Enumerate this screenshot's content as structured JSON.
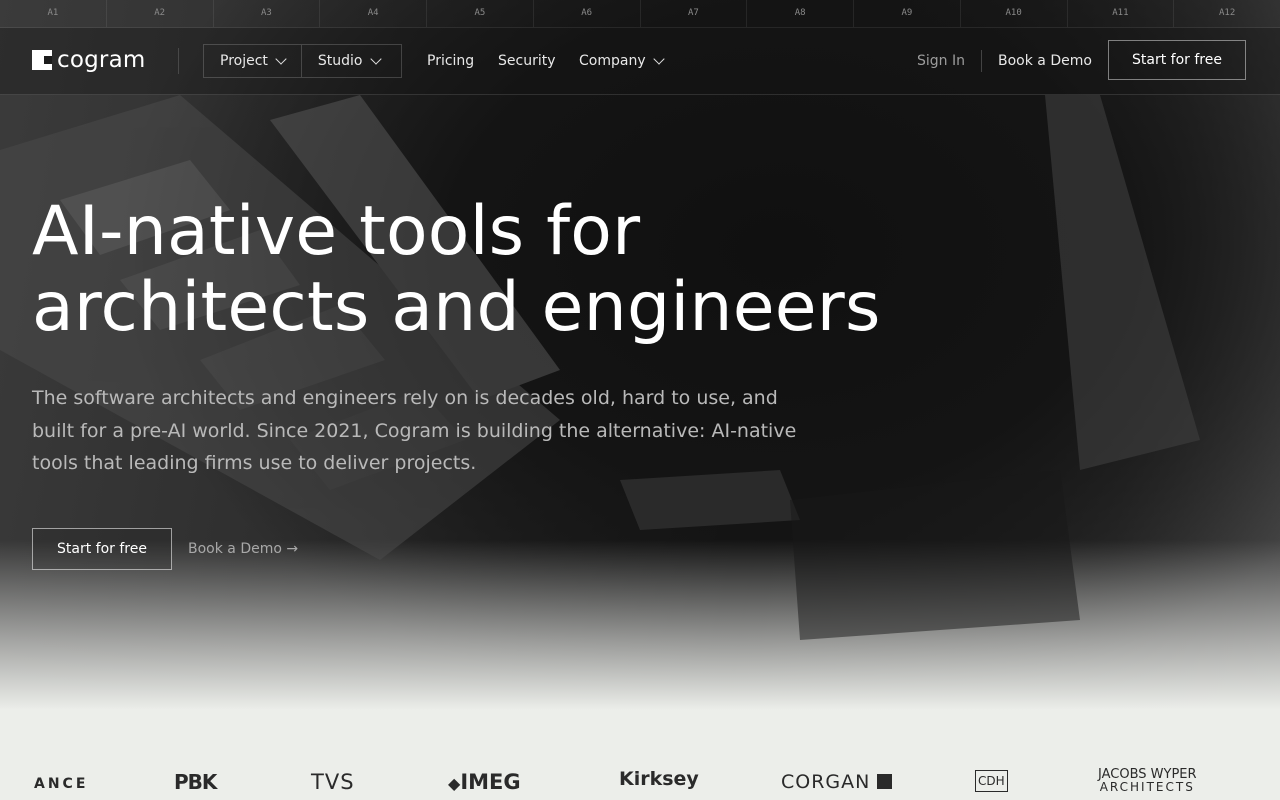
{
  "columns": [
    "A1",
    "A2",
    "A3",
    "A4",
    "A5",
    "A6",
    "A7",
    "A8",
    "A9",
    "A10",
    "A11",
    "A12"
  ],
  "brand": {
    "name": "cogram"
  },
  "nav": {
    "dropdowns": [
      {
        "label": "Project"
      },
      {
        "label": "Studio"
      }
    ],
    "links": [
      "Pricing",
      "Security"
    ],
    "company": "Company",
    "sign_in": "Sign In",
    "book_demo": "Book a Demo",
    "start_free": "Start for free"
  },
  "hero": {
    "headline_line1": "AI-native tools for",
    "headline_line2": "architects and engineers",
    "subcopy": "The software architects and engineers rely on is decades old, hard to use, and built for a pre-AI world. Since 2021, Cogram is building the alternative: AI-native tools that leading firms use to deliver projects.",
    "cta_primary": "Start for free",
    "cta_secondary": "Book a Demo →"
  },
  "clients": [
    "ANCE",
    "PBK",
    "TVS",
    "IMEG",
    "Kirksey",
    "CORGAN",
    "CDH",
    "JACOBS WYPER",
    "ARCHITECTS"
  ],
  "colors": {
    "background": "#1a1a1a",
    "light_band": "#eceeea",
    "text": "#ffffff",
    "muted": "#b9b9b9"
  }
}
